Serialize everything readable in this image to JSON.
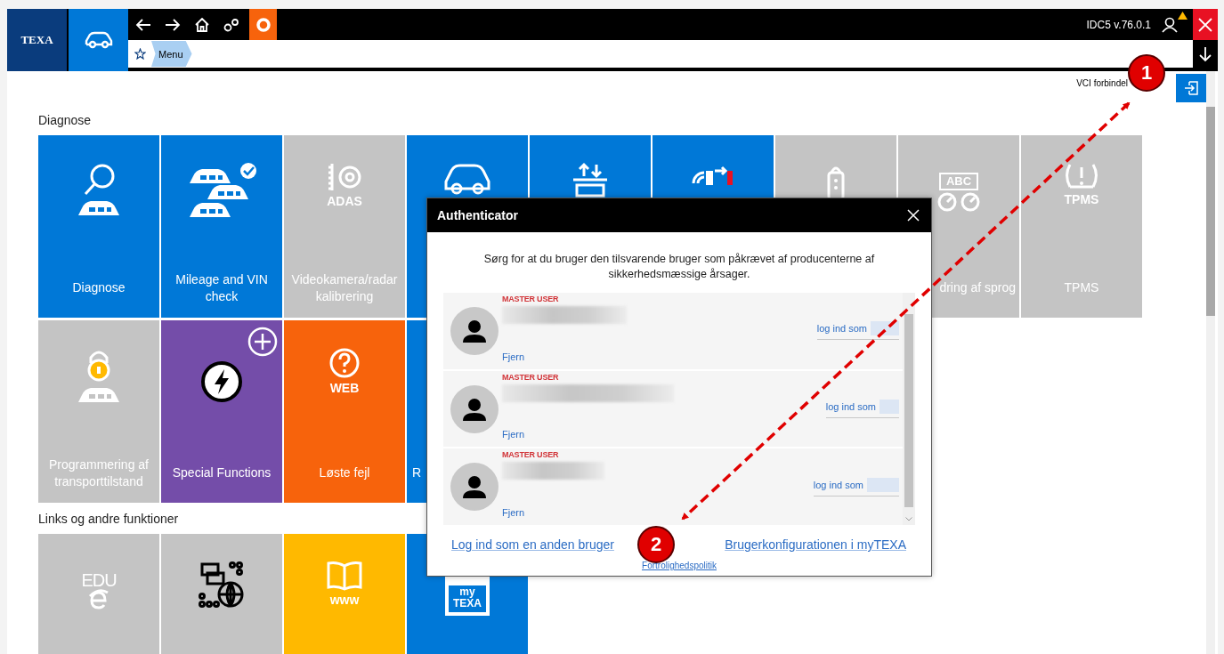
{
  "header": {
    "logo": "TEXA",
    "version": "IDC5 v.76.0.1",
    "user_warning": true,
    "breadcrumb": [
      "Menu"
    ]
  },
  "vci_status": "VCI forbindel",
  "sections": [
    {
      "title": "Diagnose",
      "tiles": [
        {
          "label": "Diagnose",
          "color": "#0078d7",
          "kind": "search"
        },
        {
          "label": "Mileage and VIN check",
          "color": "#0078d7",
          "kind": "cars"
        },
        {
          "label": "Videokamera/radar kalibrering",
          "color": "#c4c4c4",
          "kind": "adas",
          "icon_text": "ADAS"
        },
        {
          "color": "#0078d7",
          "kind": "car"
        },
        {
          "color": "#0078d7",
          "kind": "transfer"
        },
        {
          "color": "#0078d7",
          "kind": "sensor"
        },
        {
          "color": "#c4c4c4",
          "kind": "key"
        },
        {
          "label": "dring af sprog",
          "color": "#c4c4c4",
          "kind": "language",
          "icon_text": "ABC"
        },
        {
          "label": "TPMS",
          "color": "#c4c4c4",
          "kind": "tpms",
          "icon_text": "TPMS"
        },
        {
          "label": "Programmering af transporttilstand",
          "color": "#c4c4c4",
          "kind": "lock"
        },
        {
          "label": "Special Functions",
          "color": "#744da9",
          "kind": "bolt"
        },
        {
          "label": "Løste fejl",
          "color": "#f7630c",
          "kind": "help",
          "icon_text": "WEB"
        },
        {
          "label": "R",
          "color": "#0078d7",
          "kind": "blank"
        }
      ]
    },
    {
      "title": "Links og andre funktioner",
      "tiles": [
        {
          "color": "#c4c4c4",
          "kind": "edu",
          "icon_text": "EDU"
        },
        {
          "color": "#c4c4c4",
          "kind": "network"
        },
        {
          "color": "#ffb900",
          "kind": "book",
          "icon_text": "www"
        },
        {
          "color": "#0078d7",
          "kind": "mytexa",
          "icon_text": "my TEXA"
        }
      ]
    }
  ],
  "dialog": {
    "title": "Authenticator",
    "message": "Sørg for at du bruger den tilsvarende bruger som påkrævet af producenterne af sikkerhedsmæssige årsager.",
    "users": [
      {
        "role": "MASTER USER",
        "remove": "Fjern",
        "login": "log ind som"
      },
      {
        "role": "MASTER USER",
        "remove": "Fjern",
        "login": "log ind som"
      },
      {
        "role": "MASTER USER",
        "remove": "Fjern",
        "login": "log ind som"
      }
    ],
    "other_user": "Log ind som en anden bruger",
    "config_link": "Brugerkonfigurationen i myTEXA",
    "privacy": "Fortrolighedspolitik"
  },
  "callouts": [
    {
      "number": "1"
    },
    {
      "number": "2"
    }
  ]
}
